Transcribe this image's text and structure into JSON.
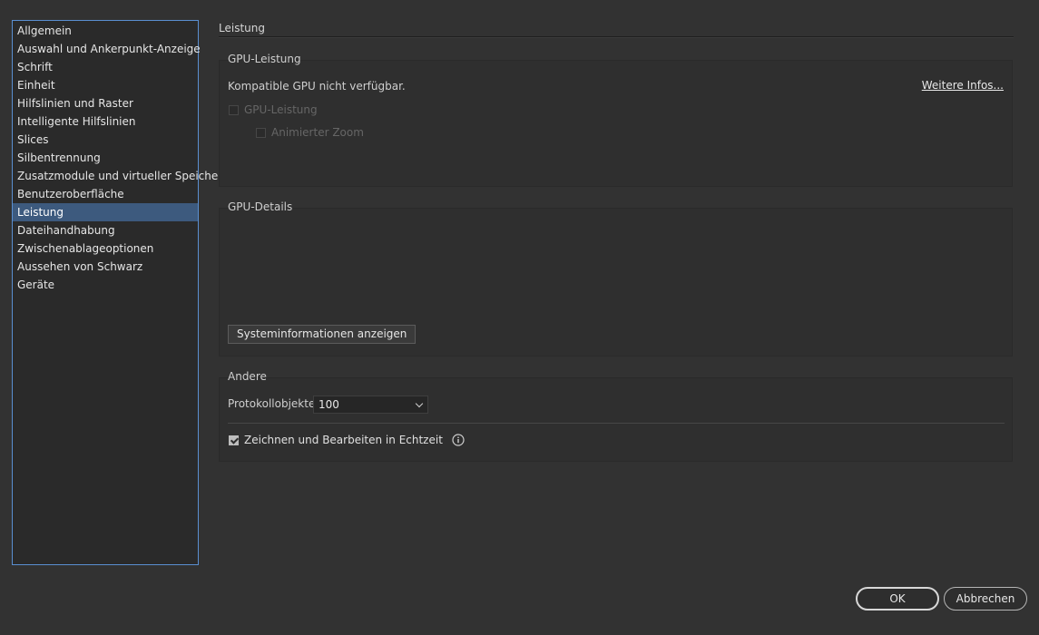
{
  "sidebar": {
    "items": [
      {
        "label": "Allgemein"
      },
      {
        "label": "Auswahl und Ankerpunkt-Anzeige"
      },
      {
        "label": "Schrift"
      },
      {
        "label": "Einheit"
      },
      {
        "label": "Hilfslinien und Raster"
      },
      {
        "label": "Intelligente Hilfslinien"
      },
      {
        "label": "Slices"
      },
      {
        "label": "Silbentrennung"
      },
      {
        "label": "Zusatzmodule und virtueller Speicher"
      },
      {
        "label": "Benutzeroberfläche"
      },
      {
        "label": "Leistung"
      },
      {
        "label": "Dateihandhabung"
      },
      {
        "label": "Zwischenablageoptionen"
      },
      {
        "label": "Aussehen von Schwarz"
      },
      {
        "label": "Geräte"
      }
    ],
    "selected": "Leistung"
  },
  "main": {
    "section_title": "Leistung",
    "gpu": {
      "label": "GPU-Leistung",
      "status": "Kompatible GPU nicht verfügbar.",
      "more_link": "Weitere Infos...",
      "gpu_checkbox": {
        "label": "GPU-Leistung",
        "checked": false,
        "enabled": false
      },
      "zoom_checkbox": {
        "label": "Animierter Zoom",
        "checked": false,
        "enabled": false
      }
    },
    "details": {
      "label": "GPU-Details",
      "sys_button": "Systeminformationen anzeigen"
    },
    "andere": {
      "label": "Andere",
      "protokoll_label": "Protokollobjekte:",
      "protokoll_value": "100",
      "realtime_checkbox": {
        "label": "Zeichnen und Bearbeiten in Echtzeit",
        "checked": true
      }
    }
  },
  "footer": {
    "ok_label": "OK",
    "cancel_label": "Abbrechen"
  },
  "icons": {
    "info": "info-icon",
    "chevron": "chevron-down-icon"
  },
  "colors": {
    "background": "#323232",
    "selection": "#3d5a7e",
    "sidebar_border": "#5a8fd1"
  }
}
